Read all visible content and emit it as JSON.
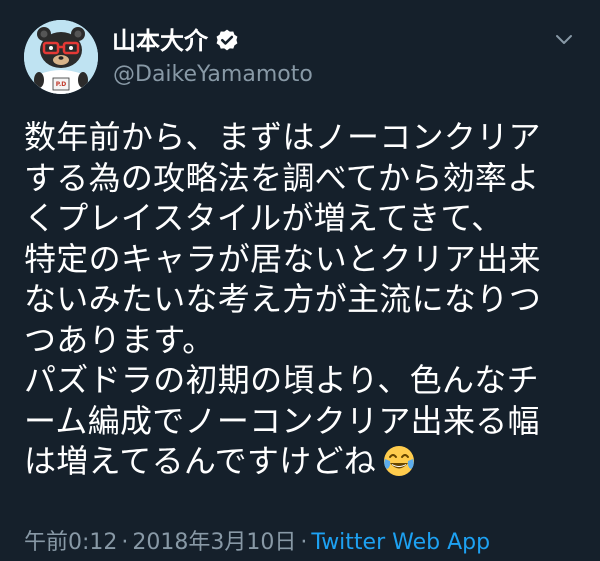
{
  "tweet": {
    "display_name": "山本大介",
    "handle": "@DaikeYamamoto",
    "verified": true,
    "text_lines": [
      "数年前から、まずはノーコンクリア",
      "する為の攻略法を調べてから効率よ",
      "くプレイスタイルが増えてきて、",
      "特定のキャラが居ないとクリア出来",
      "ないみたいな考え方が主流になりつ",
      "つあります。",
      "パズドラの初期の頃より、色んなチ",
      "ーム編成でノーコンクリア出来る幅",
      "は増えてるんですけどね"
    ],
    "emoji": "face-with-tears-of-joy",
    "time": "午前0:12",
    "separator": "·",
    "date": "2018年3月10日",
    "source": "Twitter Web App"
  },
  "colors": {
    "background": "#15202b",
    "text": "#ffffff",
    "secondary_text": "#8899a6",
    "link": "#1da1f2",
    "verified_badge": "#ffffff"
  },
  "icons": {
    "verified": "verified-badge-icon",
    "more": "chevron-down-icon",
    "avatar": "bear-mascot-avatar"
  }
}
